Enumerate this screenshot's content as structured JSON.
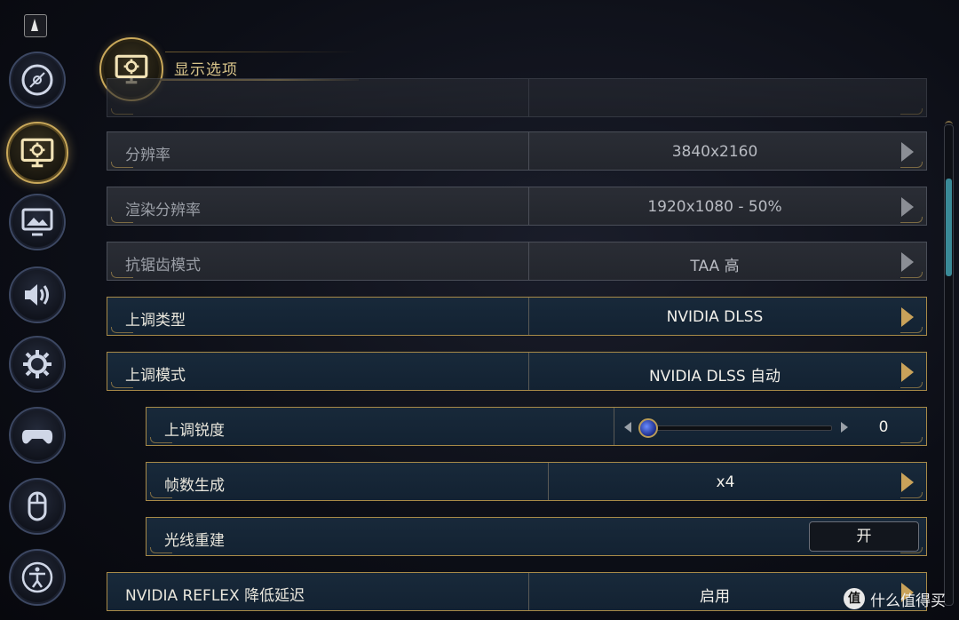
{
  "header": {
    "title": "显示选项"
  },
  "sidebar": {
    "items": [
      {
        "icon": "disc-icon",
        "active": false
      },
      {
        "icon": "monitor-gear-icon",
        "active": true
      },
      {
        "icon": "monitor-image-icon",
        "active": false
      },
      {
        "icon": "speaker-icon",
        "active": false
      },
      {
        "icon": "gear-icon",
        "active": false
      },
      {
        "icon": "gamepad-icon",
        "active": false
      },
      {
        "icon": "mouse-icon",
        "active": false
      },
      {
        "icon": "accessibility-icon",
        "active": false
      }
    ]
  },
  "settings": [
    {
      "label": "分辨率",
      "value": "3840x2160",
      "enabled": false
    },
    {
      "label": "渲染分辨率",
      "value": "1920x1080 - 50%",
      "enabled": false
    },
    {
      "label": "抗锯齿模式",
      "value": "TAA 高",
      "enabled": false
    },
    {
      "label": "上调类型",
      "value": "NVIDIA DLSS",
      "enabled": true
    },
    {
      "label": "上调模式",
      "value": "NVIDIA DLSS 自动",
      "enabled": true
    },
    {
      "label": "上调锐度",
      "value": "0",
      "enabled": true,
      "control": "slider",
      "slider_fraction": 0.0
    },
    {
      "label": "帧数生成",
      "value": "x4",
      "enabled": true
    },
    {
      "label": "光线重建",
      "value": "开",
      "enabled": true,
      "control": "toggle"
    },
    {
      "label": "NVIDIA REFLEX 降低延迟",
      "value": "启用",
      "enabled": true
    }
  ],
  "watermark": {
    "logo": "值",
    "text": "什么值得买"
  },
  "colors": {
    "gold": "#c9a85a",
    "row_active_bg": "#18293a",
    "row_disabled_bg": "#2a2d35",
    "scroll_thumb": "#3a8a98"
  }
}
